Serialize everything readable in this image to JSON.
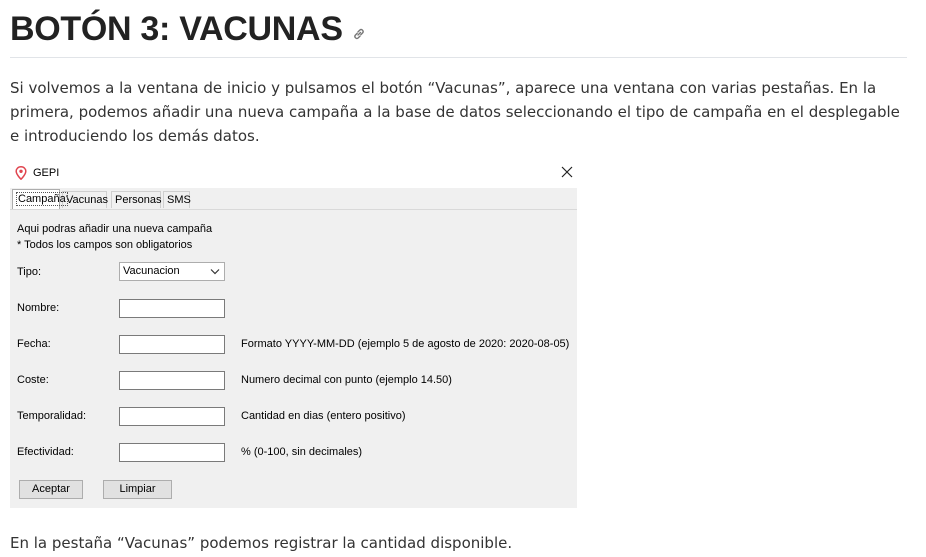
{
  "heading": {
    "title": "BOTÓN 3: VACUNAS"
  },
  "intro_text": "Si volvemos a la ventana de inicio y pulsamos el botón “Vacunas”, aparece una ventana con varias pestañas. En la primera, podemos añadir una nueva campaña a la base de datos seleccionando el tipo de campaña en el desplegable e introduciendo los demás datos.",
  "window": {
    "title": "GEPI",
    "tabs": [
      "Campaña",
      "Vacunas",
      "Personas",
      "SMS"
    ],
    "active_tab": "Campaña",
    "info_line1": "Aqui podras añadir una nueva campaña",
    "info_line2": "* Todos los campos son obligatorios",
    "form": {
      "tipo_label": "Tipo:",
      "tipo_value": "Vacunacion",
      "nombre_label": "Nombre:",
      "nombre_value": "",
      "fecha_label": "Fecha:",
      "fecha_value": "",
      "fecha_help": "Formato YYYY-MM-DD (ejemplo 5 de agosto de 2020: 2020-08-05)",
      "coste_label": "Coste:",
      "coste_value": "",
      "coste_help": "Numero decimal con punto (ejemplo 14.50)",
      "temporalidad_label": "Temporalidad:",
      "temporalidad_value": "",
      "temporalidad_help": "Cantidad en dias (entero positivo)",
      "efectividad_label": "Efectividad:",
      "efectividad_value": "",
      "efectividad_help": "% (0-100, sin decimales)"
    },
    "buttons": {
      "accept": "Aceptar",
      "clear": "Limpiar"
    }
  },
  "outro_text": "En la pestaña “Vacunas” podemos registrar la cantidad disponible.",
  "colors": {
    "accent_pin": "#e0454f",
    "panel_bg": "#f0f0f0"
  }
}
